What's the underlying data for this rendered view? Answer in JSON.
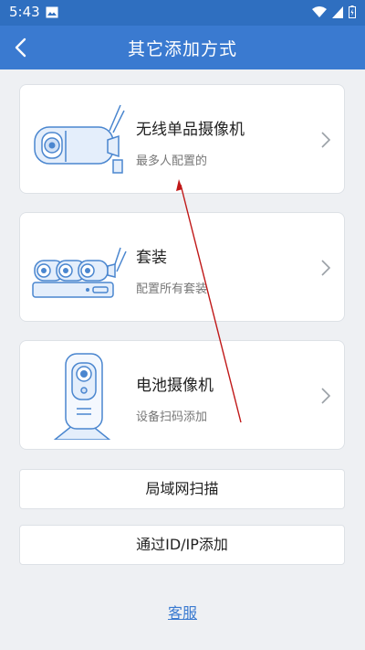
{
  "status_bar": {
    "time": "5:43",
    "icons": [
      "image-icon",
      "wifi-icon",
      "signal-icon",
      "battery-icon"
    ]
  },
  "header": {
    "title": "其它添加方式",
    "back_icon": "back-arrow-icon"
  },
  "options": [
    {
      "title": "无线单品摄像机",
      "subtitle": "最多人配置的",
      "icon": "bullet-camera-illustration"
    },
    {
      "title": "套装",
      "subtitle": "配置所有套装",
      "icon": "nvr-kit-illustration"
    },
    {
      "title": "电池摄像机",
      "subtitle": "设备扫码添加",
      "icon": "battery-camera-illustration"
    }
  ],
  "buttons": {
    "lan_scan": "局域网扫描",
    "add_by_id_ip": "通过ID/IP添加"
  },
  "footer": {
    "service_label": "客服"
  },
  "colors": {
    "header_blue": "#3a7ad0",
    "status_bar_blue": "#2f6fc0",
    "background": "#eef0f3",
    "annotation_arrow": "#c01818"
  }
}
